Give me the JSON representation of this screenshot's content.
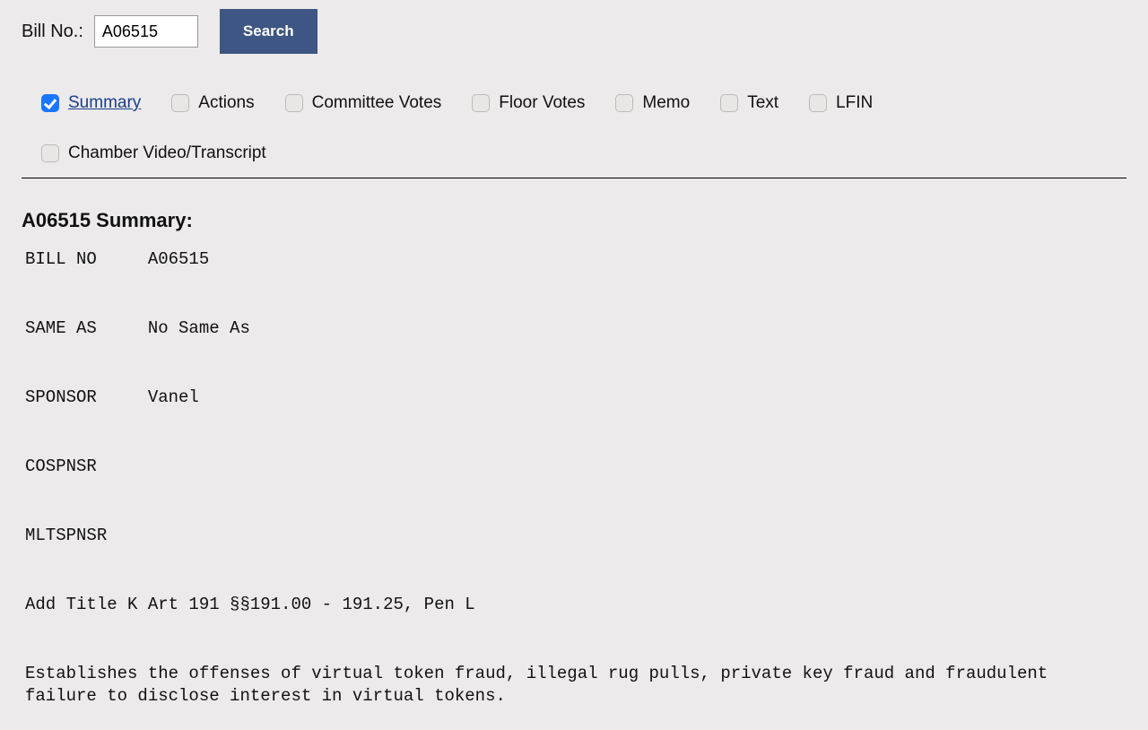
{
  "search": {
    "label": "Bill No.:",
    "value": "A06515",
    "button": "Search"
  },
  "tabs": [
    {
      "label": "Summary",
      "checked": true,
      "active": true
    },
    {
      "label": "Actions",
      "checked": false,
      "active": false
    },
    {
      "label": "Committee Votes",
      "checked": false,
      "active": false
    },
    {
      "label": "Floor Votes",
      "checked": false,
      "active": false
    },
    {
      "label": "Memo",
      "checked": false,
      "active": false
    },
    {
      "label": "Text",
      "checked": false,
      "active": false
    },
    {
      "label": "LFIN",
      "checked": false,
      "active": false
    },
    {
      "label": "Chamber Video/Transcript",
      "checked": false,
      "active": false
    }
  ],
  "summary": {
    "heading": "A06515 Summary:",
    "fields": [
      {
        "name": "BILL NO",
        "value": "A06515"
      },
      {
        "name": "SAME AS",
        "value": "No Same As"
      },
      {
        "name": "SPONSOR",
        "value": "Vanel"
      },
      {
        "name": "COSPNSR",
        "value": ""
      },
      {
        "name": "MLTSPNSR",
        "value": ""
      }
    ],
    "amendment": "Add Title K Art 191 §§191.00 - 191.25, Pen L",
    "description": "Establishes the offenses of virtual token fraud, illegal rug pulls, private key fraud and fraudulent failure to disclose interest in virtual tokens."
  }
}
